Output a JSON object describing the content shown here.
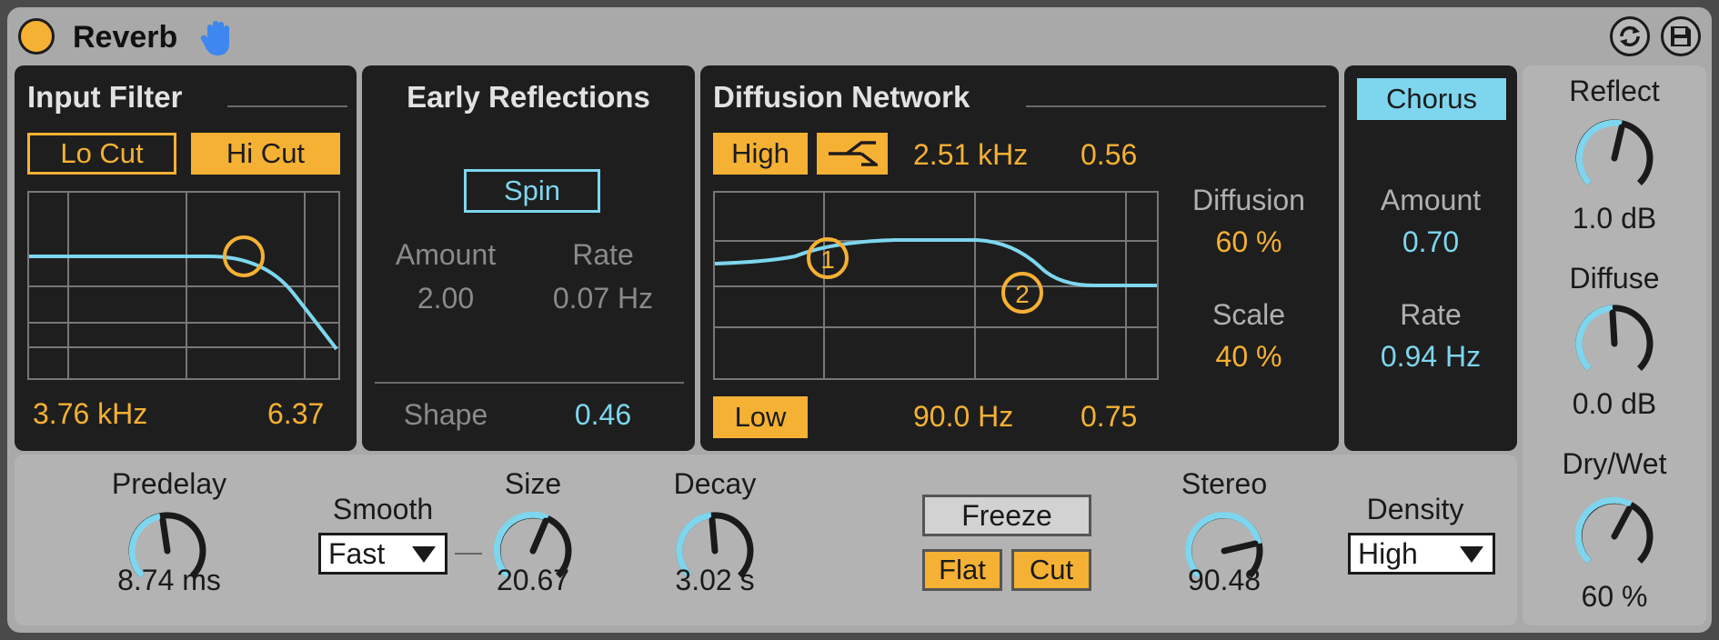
{
  "device": {
    "title": "Reverb",
    "accent_orange": "#f5b133",
    "accent_blue": "#7dd6ee",
    "icons": [
      "power-button-icon",
      "hand-icon",
      "hot-swap-icon",
      "save-preset-icon"
    ]
  },
  "input_filter": {
    "title": "Input Filter",
    "lo_cut_label": "Lo Cut",
    "hi_cut_label": "Hi Cut",
    "freq": "3.76 kHz",
    "q": "6.37"
  },
  "early_reflections": {
    "title": "Early Reflections",
    "spin_label": "Spin",
    "amount_label": "Amount",
    "amount_value": "2.00",
    "rate_label": "Rate",
    "rate_value": "0.07 Hz",
    "shape_label": "Shape",
    "shape_value": "0.46"
  },
  "diffusion_network": {
    "title": "Diffusion Network",
    "high_label": "High",
    "shelf_icon": "shelf-filter-icon",
    "high_freq": "2.51 kHz",
    "high_value": "0.56",
    "low_label": "Low",
    "low_freq": "90.0 Hz",
    "low_value": "0.75",
    "point1": "1",
    "point2": "2",
    "diffusion_label": "Diffusion",
    "diffusion_value": "60 %",
    "scale_label": "Scale",
    "scale_value": "40 %"
  },
  "chorus": {
    "label": "Chorus",
    "amount_label": "Amount",
    "amount_value": "0.70",
    "rate_label": "Rate",
    "rate_value": "0.94 Hz"
  },
  "bottom": {
    "predelay_label": "Predelay",
    "predelay_value": "8.74 ms",
    "smooth_label": "Smooth",
    "smooth_value": "Fast",
    "size_label": "Size",
    "size_value": "20.67",
    "decay_label": "Decay",
    "decay_value": "3.02 s",
    "freeze_label": "Freeze",
    "flat_label": "Flat",
    "cut_label": "Cut",
    "stereo_label": "Stereo",
    "stereo_value": "90.48",
    "density_label": "Density",
    "density_value": "High"
  },
  "side": {
    "reflect_label": "Reflect",
    "reflect_value": "1.0 dB",
    "diffuse_label": "Diffuse",
    "diffuse_value": "0.0 dB",
    "drywet_label": "Dry/Wet",
    "drywet_value": "60 %"
  }
}
